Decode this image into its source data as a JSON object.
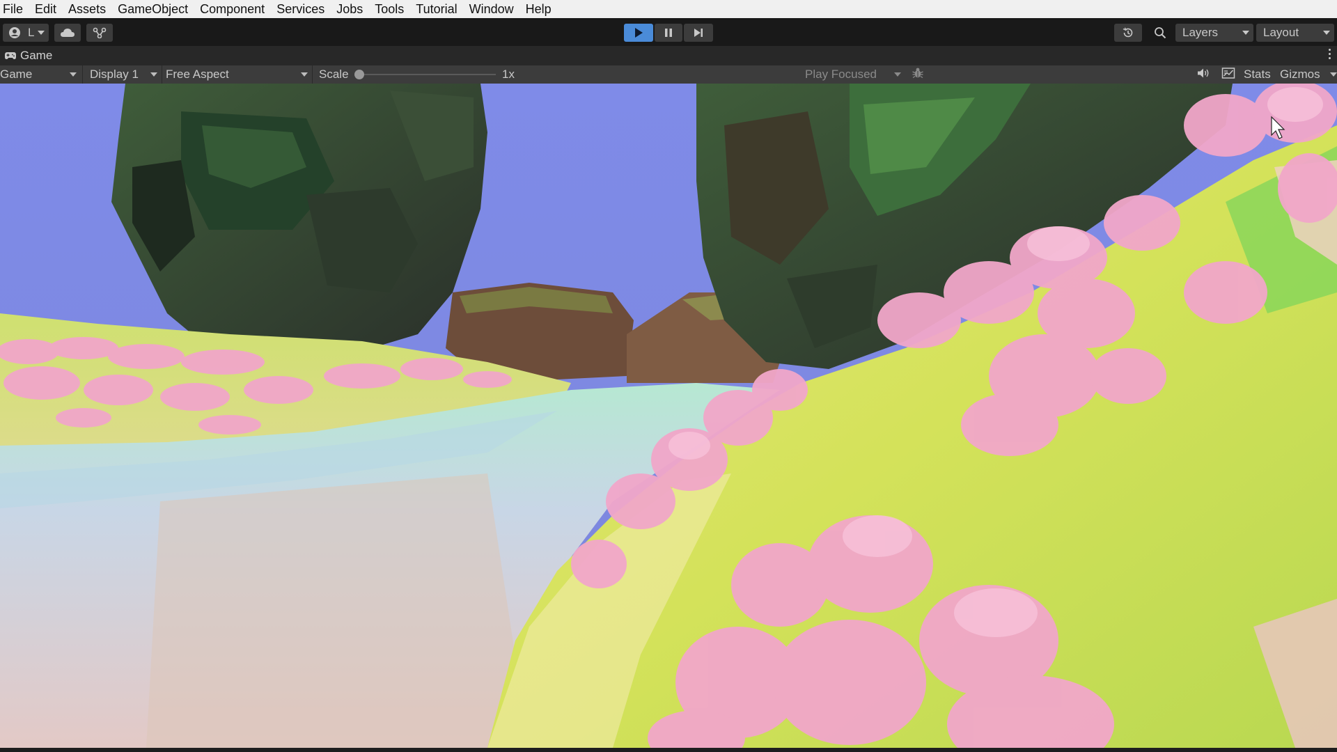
{
  "menu": [
    "File",
    "Edit",
    "Assets",
    "GameObject",
    "Component",
    "Services",
    "Jobs",
    "Tools",
    "Tutorial",
    "Window",
    "Help"
  ],
  "toolbar": {
    "account_label": "L",
    "layers_label": "Layers",
    "layout_label": "Layout",
    "play_active": true,
    "accent_color": "#4a8bd8"
  },
  "tab": {
    "title": "Game"
  },
  "controls": {
    "mode": "Game",
    "display": "Display 1",
    "aspect": "Free Aspect",
    "scale_label": "Scale",
    "scale_value": "1x",
    "play_mode": "Play Focused",
    "stats_label": "Stats",
    "gizmos_label": "Gizmos"
  },
  "scene": {
    "description_colors": {
      "sky": "#7e8ce6",
      "grass": "#d8e25a",
      "flowers": "#f0a6c8",
      "water": "#a8e0c8",
      "rock": "#2f3a2c"
    }
  }
}
